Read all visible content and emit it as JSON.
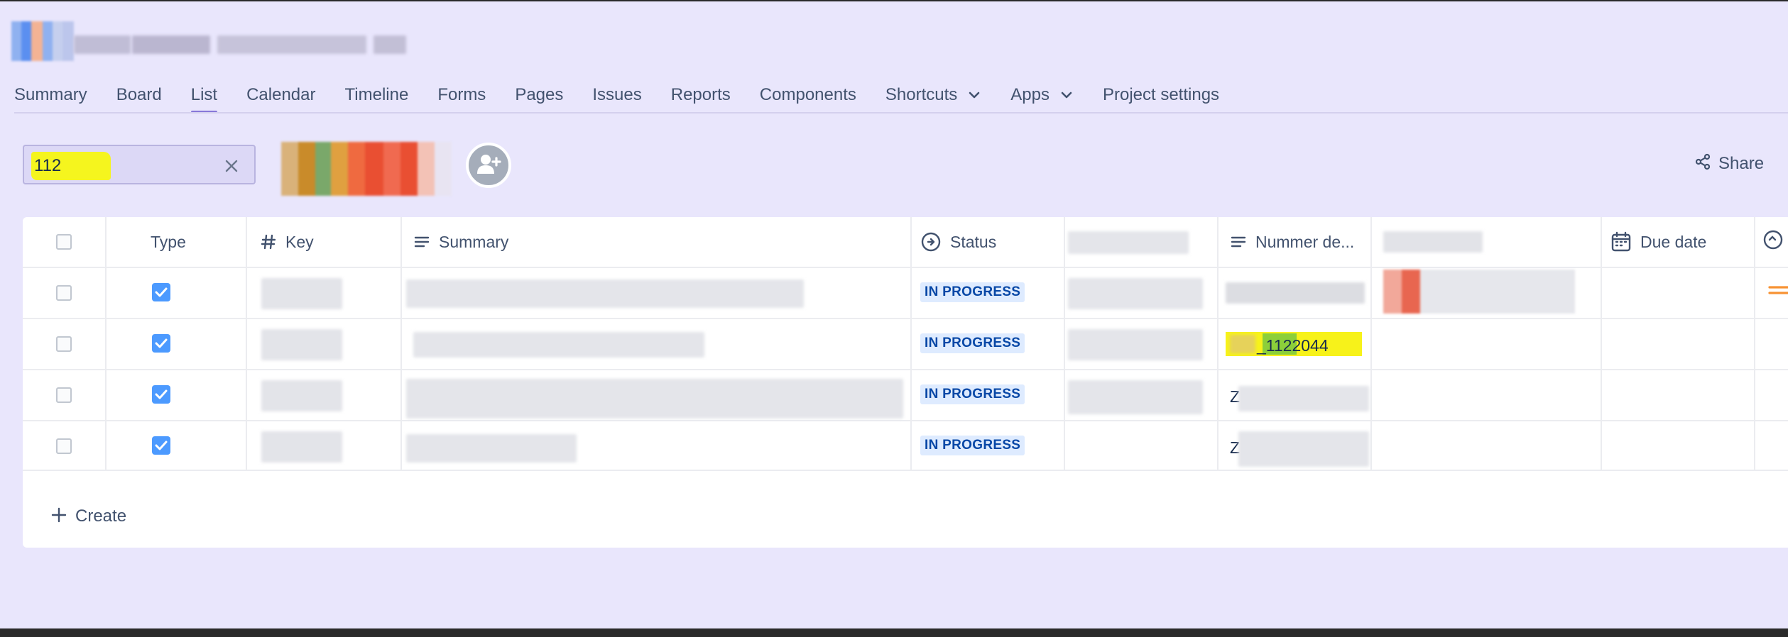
{
  "nav": {
    "tabs": [
      {
        "label": "Summary"
      },
      {
        "label": "Board"
      },
      {
        "label": "List"
      },
      {
        "label": "Calendar"
      },
      {
        "label": "Timeline"
      },
      {
        "label": "Forms"
      },
      {
        "label": "Pages"
      },
      {
        "label": "Issues"
      },
      {
        "label": "Reports"
      },
      {
        "label": "Components"
      },
      {
        "label": "Shortcuts"
      },
      {
        "label": "Apps"
      },
      {
        "label": "Project settings"
      }
    ],
    "active_tab": "List"
  },
  "search": {
    "value": "112"
  },
  "toolbar": {
    "share_label": "Share"
  },
  "table": {
    "headers": {
      "type": "Type",
      "key": "Key",
      "summary": "Summary",
      "status": "Status",
      "nummer": "Nummer de...",
      "due_date": "Due date"
    },
    "rows": [
      {
        "type_checked": true,
        "status": "IN PROGRESS",
        "nummer": ""
      },
      {
        "type_checked": true,
        "status": "IN PROGRESS",
        "nummer": "_1122044"
      },
      {
        "type_checked": true,
        "status": "IN PROGRESS",
        "nummer": "Z"
      },
      {
        "type_checked": true,
        "status": "IN PROGRESS",
        "nummer": "Z"
      }
    ],
    "create_label": "Create"
  },
  "colors": {
    "background": "#e9e6fc",
    "active_tab_underline": "#8777d9",
    "lozenge_bg": "#deebff",
    "lozenge_text": "#0747a6",
    "search_highlight": "#f5f51e"
  },
  "icons": [
    "clear-icon",
    "add-people-icon",
    "share-icon",
    "hash-icon",
    "lines-icon",
    "status-icon",
    "calendar-icon",
    "plus-icon",
    "chevron-down-icon",
    "check-icon"
  ]
}
